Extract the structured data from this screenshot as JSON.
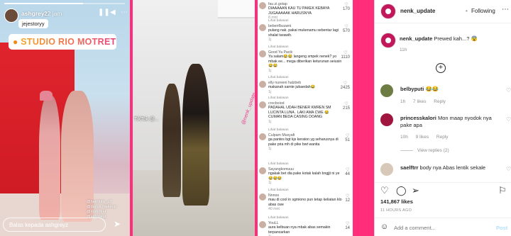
{
  "story": {
    "progress": 0.65,
    "username": "ashgreyz",
    "time": "22 jam",
    "pause_icon": "pause-icon",
    "mute_icon": "mute-icon",
    "more_icon": "more-icon",
    "mention": "jejestoryy",
    "location": "STUDIO RIO MOTRET",
    "credits": [
      "@hairdoby_cll",
      "@darius.makeup",
      "@riomotret",
      "@ashgreyz"
    ],
    "reply_placeholder": "Balas kepada ashgreyz",
    "send_icon": "send-icon"
  },
  "photo": {
    "tiktok": "TikTok",
    "tiktok_handle": "@...",
    "watermark": "@nenk_update"
  },
  "comments_shot": [
    {
      "user": "fau.zi.gotap",
      "text": "DIAAAAAN KAU TU PAKEK KEBAYA JUGAAAAAK HARUSNYA",
      "time": "8 mnt",
      "likes": "170"
    },
    {
      "user": "bebenfbuuwni",
      "text": "pulang nak. pakai mukenamu sebentar lagi shalat tarawih.",
      "time": "1j",
      "likes": "570"
    },
    {
      "user": "Good Ya Pacik",
      "text": "Ya salam😂😂 langeng smpek nenek? yo mbak ee... mega diberikan keturunan seiusin 😂😂",
      "time": "1j",
      "likes": "1110"
    },
    {
      "user": "elly nureeni halzbeb",
      "text": "makanah samte jubaedah😂",
      "time": "1j",
      "likes": "2425"
    },
    {
      "user": "crocboiod",
      "text": "PADAHAL UDAH BENER KMREN SM LUCINTA LUNA . LAKI AMA CWE 😂 CUMAN BEDA CASING DOANG",
      "time": "1j",
      "likes": "215"
    },
    {
      "user": "Culpam Musyafi",
      "text": "ga pantes bgt kjs keraton yg seharusnya di pake pria mh di pike bwt wanita",
      "time": "1j",
      "likes": "51"
    },
    {
      "user": "Sayangkomuuu",
      "text": "ngakak bet dia pake kotak kalah bngjjt ni ye😂😂😂",
      "time": "1j",
      "likes": "44"
    },
    {
      "user": "Nnnoo",
      "text": "mau di cool in sgmiono pun tetap keliatan klo abas cwe",
      "time": "40 mnt",
      "likes": "12"
    },
    {
      "user": "YouLL",
      "text": "aura kelbuan nya mbak abas semakin terpancarkan",
      "time": "1j",
      "likes": "14"
    }
  ],
  "comments_shot_more": "Lihat balasan",
  "panel": {
    "account": "nenk_update",
    "separator": "•",
    "follow": "Following",
    "more_icon": "more-dots-icon",
    "caption": "Prewed kah...? 😨",
    "caption_time": "11h",
    "load_more_icon": "plus-circle-icon",
    "comments": [
      {
        "user": "belbyputi",
        "text": "😂😂",
        "time": "1h",
        "likes": "7 likes",
        "reply": "Reply",
        "color": "#6d7c42"
      },
      {
        "user": "princesskalori",
        "text": "Mon maap nyodok nya pake apa",
        "time": "10h",
        "likes": "9 likes",
        "reply": "Reply",
        "color": "#a0153e"
      },
      {
        "user": "saelftrr",
        "text": "body nya Abas lentik sekale",
        "time": "",
        "likes": "",
        "reply": "",
        "color": "#d8c8b8"
      }
    ],
    "view_replies": "View replies (2)",
    "like_count": "141,867 likes",
    "posted": "11 HOURS AGO",
    "add_comment_placeholder": "Add a comment...",
    "post": "Post",
    "icons": {
      "like": "heart-icon",
      "comment": "comment-icon",
      "share": "share-icon",
      "save": "bookmark-icon",
      "emoji": "emoji-icon"
    }
  }
}
